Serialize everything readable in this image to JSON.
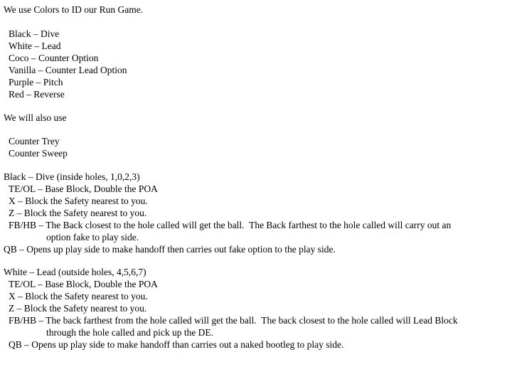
{
  "document": {
    "background_color": "#ffffff",
    "text_color": "#000000",
    "intro": {
      "heading": "We use Colors to ID our Run Game."
    },
    "color_key": [
      "Black – Dive",
      "White – Lead",
      "Coco – Counter Option",
      "Vanilla – Counter Lead Option",
      "Purple – Pitch",
      "Red – Reverse"
    ],
    "also_use": {
      "heading": "We will also use",
      "items": [
        "Counter Trey",
        "Counter Sweep"
      ]
    },
    "black_dive": {
      "title": "Black – Dive (inside holes, 1,0,2,3)",
      "assignments": [
        "TE/OL – Base Block, Double the POA",
        "X – Block the Safety nearest to you.",
        "Z – Block the Safety nearest to you.",
        "FB/HB – The Back closest to the hole called will get the ball.  The Back farthest to the hole called will carry out an"
      ],
      "continuation": "option fake to play side.",
      "qb": "QB – Opens up play side to make handoff then carries out fake option to the play side."
    },
    "white_lead": {
      "title": "White – Lead (outside holes, 4,5,6,7)",
      "assignments": [
        "TE/OL – Base Block, Double the POA",
        "X – Block the Safety nearest to you.",
        "Z – Block the Safety nearest to you.",
        "FB/HB – The back farthest from the hole called will get the ball.  The back closest to the hole called will Lead Block"
      ],
      "continuation": "through the hole called and pick up the DE.",
      "qb": "QB – Opens up play side to make handoff than carries out a naked bootleg to play side."
    }
  }
}
